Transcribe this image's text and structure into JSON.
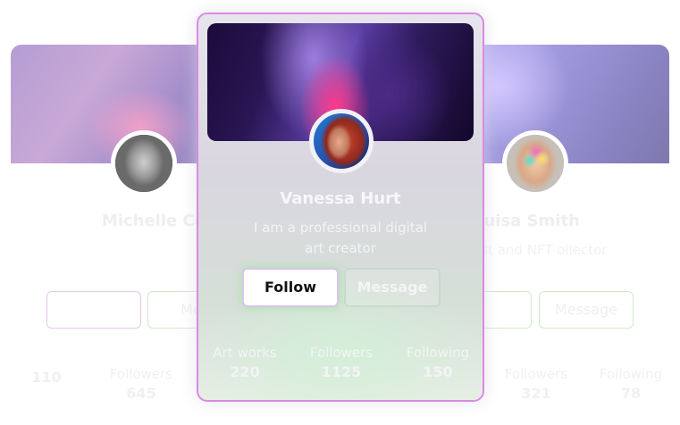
{
  "left_card": {
    "name": "Michelle Co",
    "description": "",
    "follow_label": "",
    "message_label": "Mes",
    "stats": [
      {
        "label": "",
        "value": "110"
      },
      {
        "label": "Followers",
        "value": "645"
      },
      {
        "label": "",
        "value": ""
      }
    ]
  },
  "center_card": {
    "name": "Vanessa Hurt",
    "description": "I am a professional digital art creator",
    "follow_label": "Follow",
    "message_label": "Message",
    "stats": [
      {
        "label": "Art works",
        "value": "220"
      },
      {
        "label": "Followers",
        "value": "1125"
      },
      {
        "label": "Following",
        "value": "150"
      }
    ]
  },
  "right_card": {
    "name": "ouisa Smith",
    "description": "g artist and NFT ollector",
    "follow_label": "",
    "message_label": "Message",
    "stats": [
      {
        "label": "",
        "value": ""
      },
      {
        "label": "Followers",
        "value": "321"
      },
      {
        "label": "Following",
        "value": "78"
      }
    ]
  },
  "colors": {
    "accent_border": "#d98ae6",
    "follow_glow": "#96e696"
  }
}
